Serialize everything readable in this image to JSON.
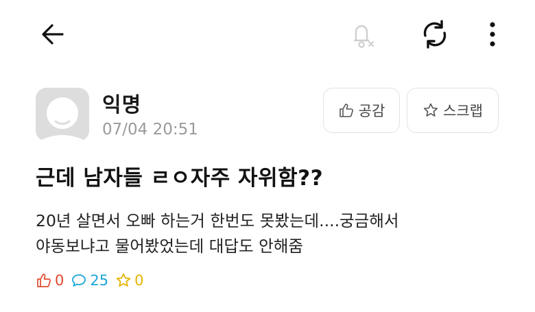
{
  "icons": {
    "back": "back-arrow-icon",
    "notify": "bell-off-icon",
    "refresh": "refresh-icon",
    "more": "more-vertical-icon",
    "avatar": "anonymous-avatar",
    "like": "thumbs-up-icon",
    "comment": "comment-icon",
    "scrap": "star-icon"
  },
  "post": {
    "author": "익명",
    "time": "07/04 20:51",
    "title": "근데 남자들 ㄹㅇ자주 자위함??",
    "body_lines": [
      "20년 살면서 오빠 하는거 한번도 못봤는데....궁금해서",
      "야동보냐고 물어봤었는데 대답도 안해줌"
    ]
  },
  "actions": {
    "like_label": "공감",
    "scrap_label": "스크랩"
  },
  "stats": {
    "likes": "0",
    "comments": "25",
    "scraps": "0"
  },
  "colors": {
    "like": "#e0492c",
    "comment": "#1ba5d8",
    "scrap": "#e8b300",
    "avatar_bg": "#dddddd"
  }
}
